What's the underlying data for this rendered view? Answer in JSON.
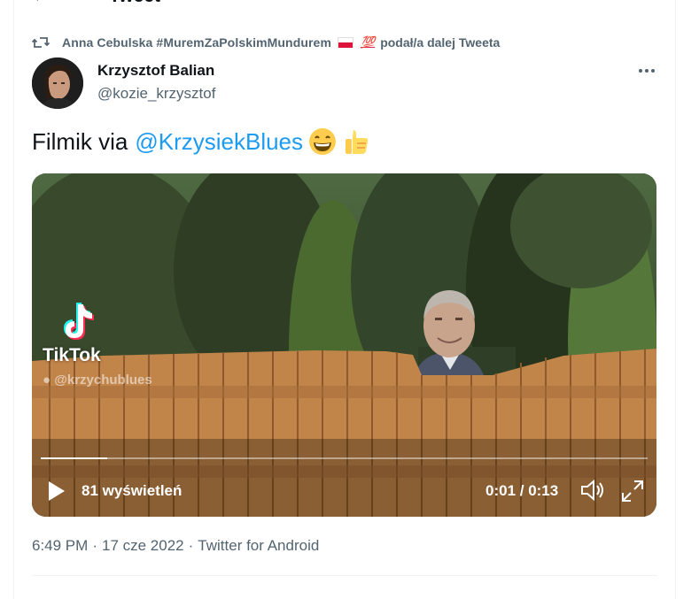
{
  "header": {
    "title": "Tweet",
    "back_icon": "arrow-left-icon"
  },
  "retweet": {
    "icon": "retweet-icon",
    "retweeter_name": "Anna Cebulska #MuremZaPolskimMundurem",
    "flag_icon": "poland-flag-emoji",
    "hundred": "💯",
    "suffix": "podał/a dalej Tweeta"
  },
  "author": {
    "name": "Krzysztof Balian",
    "handle": "@kozie_krzysztof",
    "more_icon": "more-horizontal-icon"
  },
  "tweet": {
    "text_prefix": "Filmik via",
    "mention": "@KrzysiekBlues",
    "emojis": [
      "grinning-face-emoji",
      "thumbs-up-emoji"
    ]
  },
  "video": {
    "watermark_label": "TikTok",
    "watermark_user": "@krzychublues",
    "views": "81 wyświetleń",
    "time": "0:01 / 0:13",
    "progress": 0.11,
    "play_icon": "play-icon",
    "volume_icon": "volume-icon",
    "fullscreen_icon": "fullscreen-icon"
  },
  "meta": {
    "time": "6:49 PM",
    "sep1": "·",
    "date": "17 cze 2022",
    "sep2": "·",
    "source": "Twitter for Android"
  },
  "colors": {
    "accent": "#1d9bf0",
    "text_primary": "#0f1419",
    "text_secondary": "#536471"
  }
}
